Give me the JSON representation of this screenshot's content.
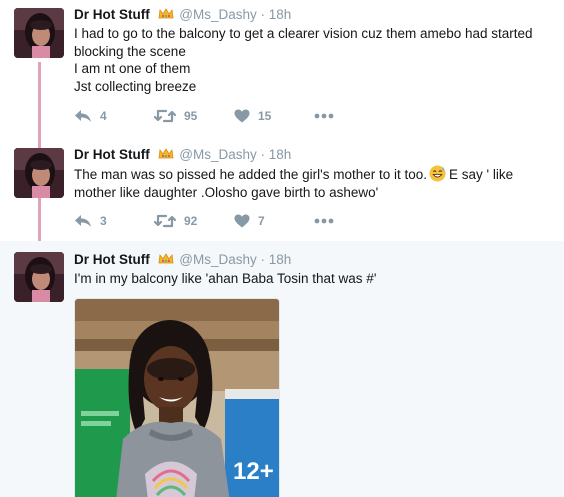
{
  "tweets": [
    {
      "author": "Dr Hot Stuff",
      "handle": "@Ms_Dashy",
      "time": "18h",
      "lines": [
        "I had to go to the balcony to get a clearer vision cuz them amebo had started",
        "blocking the scene",
        "I am nt one of them",
        "Jst collecting breeze"
      ],
      "replies": "4",
      "retweets": "95",
      "likes": "15"
    },
    {
      "author": "Dr Hot Stuff",
      "handle": "@Ms_Dashy",
      "time": "18h",
      "line1_before_emoji": "The man was so pissed he added the girl's mother to it too.",
      "line1_after_emoji": "E say ' like",
      "line2": "mother like daughter .Olosho gave birth to ashewo'",
      "replies": "3",
      "retweets": "92",
      "likes": "7"
    },
    {
      "author": "Dr Hot Stuff",
      "handle": "@Ms_Dashy",
      "time": "18h",
      "line1": "I'm in my balcony like 'ahan Baba Tosin that was #'",
      "media_sign": "12+"
    }
  ],
  "separator": "·",
  "icons": {
    "reply": "reply-icon",
    "retweet": "retweet-icon",
    "like": "heart-icon",
    "more": "more-dots-icon",
    "crown": "crown-emoji-icon",
    "sweat": "sweat-smile-emoji-icon"
  },
  "colors": {
    "thread": "#e1a3ba",
    "muted": "#8899a6",
    "highlight_bg": "#f5f8fa"
  }
}
